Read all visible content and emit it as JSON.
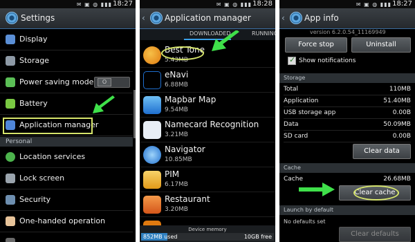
{
  "colors": {
    "highlight": "#d6e56b",
    "arrow": "#3fe04a",
    "accent": "#3aa0e8"
  },
  "panel1": {
    "time": "18:27",
    "title": "Settings",
    "items": [
      {
        "label": "Display",
        "icon": "display-icon",
        "color": "#5b8fd6"
      },
      {
        "label": "Storage",
        "icon": "storage-icon",
        "color": "#8e9aa6"
      },
      {
        "label": "Power saving mode",
        "icon": "power-saving-icon",
        "color": "#5bbf56"
      },
      {
        "label": "Battery",
        "icon": "battery-icon",
        "color": "#7ac943"
      },
      {
        "label": "Application manager",
        "icon": "apps-grid-icon",
        "color": "#4f86d9"
      }
    ],
    "toggle_label": "O",
    "section": "Personal",
    "items2": [
      {
        "label": "Location services",
        "icon": "location-icon",
        "color": "#4cb34c"
      },
      {
        "label": "Lock screen",
        "icon": "lock-icon",
        "color": "#9aa4ad"
      },
      {
        "label": "Security",
        "icon": "security-icon",
        "color": "#6e8fb0"
      },
      {
        "label": "One-handed operation",
        "icon": "hand-icon",
        "color": "#e8c49a"
      }
    ]
  },
  "panel2": {
    "time": "18:28",
    "title": "Application manager",
    "tabs": [
      "DOWNLOADED",
      "RUNNING"
    ],
    "apps": [
      {
        "name": "Best Tone",
        "size": "5.43MB",
        "icon": "best-tone-icon",
        "color": "#f0a020"
      },
      {
        "name": "eNavi",
        "size": "6.88MB",
        "icon": "enavi-icon",
        "color": "#1f6fcf"
      },
      {
        "name": "Mapbar Map",
        "size": "9.54MB",
        "icon": "mapbar-icon",
        "color": "#2f8fe0"
      },
      {
        "name": "Namecard Recognition",
        "size": "3.21MB",
        "icon": "namecard-icon",
        "color": "#e8eef5"
      },
      {
        "name": "Navigator",
        "size": "10.85MB",
        "icon": "navigator-icon",
        "color": "#3a9be6"
      },
      {
        "name": "PIM",
        "size": "6.17MB",
        "icon": "pim-icon",
        "color": "#f2b634"
      },
      {
        "name": "Restaurant",
        "size": "3.20MB",
        "icon": "restaurant-icon",
        "color": "#e8702a"
      }
    ],
    "device_memory": "Device memory",
    "used": "852MB used",
    "free": "10GB free"
  },
  "panel3": {
    "time": "18:27",
    "title": "App info",
    "version": "version 6.2.0.54_11169949",
    "force_stop": "Force stop",
    "uninstall": "Uninstall",
    "show_notifications": "Show notifications",
    "storage_header": "Storage",
    "storage": [
      {
        "k": "Total",
        "v": "110MB"
      },
      {
        "k": "Application",
        "v": "51.40MB"
      },
      {
        "k": "USB storage app",
        "v": "0.00B"
      },
      {
        "k": "Data",
        "v": "50.09MB"
      },
      {
        "k": "SD card",
        "v": "0.00B"
      }
    ],
    "clear_data": "Clear data",
    "cache_header": "Cache",
    "cache_label": "Cache",
    "cache_value": "26.68MB",
    "clear_cache": "Clear cache",
    "launch_header": "Launch by default",
    "no_defaults": "No defaults set",
    "clear_defaults": "Clear defaults"
  }
}
